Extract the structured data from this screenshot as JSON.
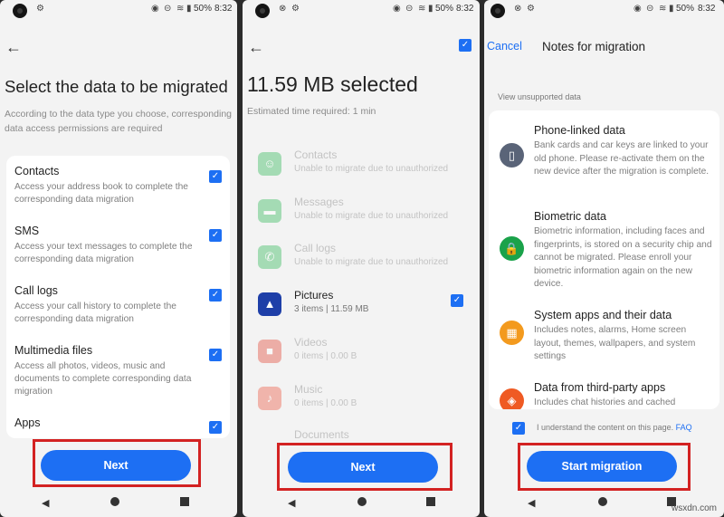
{
  "status": {
    "time": "8:32",
    "battery": "50%"
  },
  "screen1": {
    "title": "Select the data to be migrated",
    "subtitle": "According to the data type you choose, corresponding data access permissions are required",
    "items": [
      {
        "title": "Contacts",
        "desc": "Access your address book to complete the corresponding data migration",
        "checked": true
      },
      {
        "title": "SMS",
        "desc": "Access your text messages to complete the corresponding data migration",
        "checked": true
      },
      {
        "title": "Call logs",
        "desc": "Access your call history to complete the corresponding data migration",
        "checked": true
      },
      {
        "title": "Multimedia files",
        "desc": "Access all photos, videos, music and documents to complete corresponding data migration",
        "checked": true
      },
      {
        "title": "Apps",
        "desc": "",
        "checked": true
      }
    ],
    "button": "Next"
  },
  "screen2": {
    "title": "11.59 MB selected",
    "subtitle": "Estimated time required: 1 min",
    "rows": [
      {
        "name": "Contacts",
        "sub": "Unable to migrate due to unauthorized",
        "enabled": false,
        "icon": "contacts-icon"
      },
      {
        "name": "Messages",
        "sub": "Unable to migrate due to unauthorized",
        "enabled": false,
        "icon": "messages-icon"
      },
      {
        "name": "Call logs",
        "sub": "Unable to migrate due to unauthorized",
        "enabled": false,
        "icon": "phone-icon"
      },
      {
        "name": "Pictures",
        "sub": "3 items | 11.59 MB",
        "enabled": true,
        "checked": true,
        "icon": "pictures-icon"
      },
      {
        "name": "Videos",
        "sub": "0 items | 0.00 B",
        "enabled": false,
        "icon": "videos-icon"
      },
      {
        "name": "Music",
        "sub": "0 items | 0.00 B",
        "enabled": false,
        "icon": "music-icon"
      },
      {
        "name": "Documents",
        "sub": "",
        "enabled": false,
        "icon": "documents-icon"
      }
    ],
    "button": "Next"
  },
  "screen3": {
    "cancel": "Cancel",
    "title": "Notes for migration",
    "section": "View unsupported data",
    "notes": [
      {
        "title": "Phone-linked data",
        "desc": "Bank cards and car keys are linked to your old phone. Please re-activate them on the new device after the migration is complete.",
        "icon": "phone-linked-icon",
        "color": "#5a6478"
      },
      {
        "title": "Biometric data",
        "desc": "Biometric information, including faces and fingerprints, is stored on a security chip and cannot be migrated. Please enroll your biometric information again on the new device.",
        "icon": "lock-icon",
        "color": "#1aa24a"
      },
      {
        "title": "System apps and their data",
        "desc": "Includes notes, alarms, Home screen layout, themes, wallpapers, and system settings",
        "icon": "apps-grid-icon",
        "color": "#f39a1e"
      },
      {
        "title": "Data from third-party apps",
        "desc": "Includes chat histories and cached",
        "icon": "layers-icon",
        "color": "#ef5a23"
      }
    ],
    "agree_text": "I understand the content on this page.",
    "faq": "FAQ",
    "button": "Start migration"
  },
  "colors": {
    "accent": "#1d6ff3",
    "highlight": "#d32222"
  },
  "watermark": "wsxdn.com"
}
